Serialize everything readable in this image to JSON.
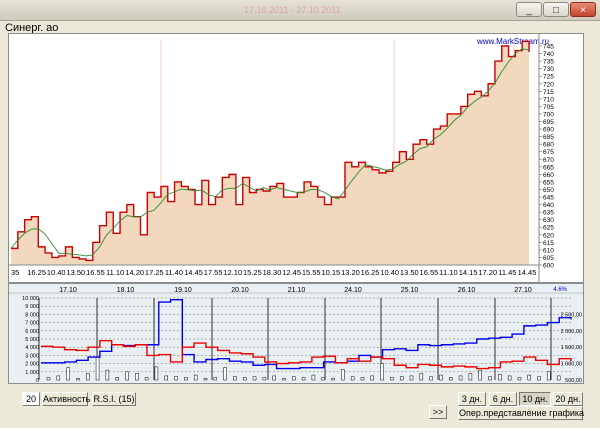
{
  "window": {
    "title_faint": "17.10.2011 - 27.10.2011",
    "minimize": "_",
    "maximize": "□",
    "close": "×"
  },
  "chart": {
    "title": "Синерг. ао",
    "watermark": "www.MarkStream.ru",
    "percent_label": "4.6%"
  },
  "price_axis": [
    "745",
    "740",
    "735",
    "730",
    "725",
    "720",
    "715",
    "710",
    "705",
    "700",
    "695",
    "690",
    "685",
    "680",
    "675",
    "670",
    "665",
    "660",
    "655",
    "650",
    "645",
    "640",
    "635",
    "630",
    "625",
    "620",
    "615",
    "610",
    "605",
    "600"
  ],
  "time_axis": [
    "35",
    "16.25",
    "10.40",
    "13.50",
    "16.55",
    "11.10",
    "14.20",
    "17.25",
    "11.40",
    "14.45",
    "17.55",
    "12.10",
    "15.25",
    "18.30",
    "12.45",
    "15.55",
    "10.15",
    "13.20",
    "16.25",
    "10.40",
    "13.50",
    "16.55",
    "11.10",
    "14.15",
    "17.20",
    "11.45",
    "14.45"
  ],
  "date_axis": [
    "17.10",
    "18.10",
    "19.10",
    "20.10",
    "21.10",
    "24.10",
    "25.10",
    "26.10",
    "27.10"
  ],
  "left_axis": [
    "10 000",
    "9 000",
    "8 000",
    "7 000",
    "6 000",
    "5 000",
    "4 000",
    "3 000",
    "2 000",
    "1 000",
    "0"
  ],
  "right_axis": [
    "2 500,00",
    "2 000,00",
    "1 500,00",
    "1 000,00",
    "500,00"
  ],
  "colors": {
    "price_line": "#cc0000",
    "price_fill": "#f2d8bf",
    "ma": "#2e8b2e",
    "blue": "#0000ee",
    "red": "#ee0000"
  },
  "toolbar": {
    "period_box": "20",
    "activity": "Активность",
    "rsi": "R.S.I. (15)",
    "forward": ">>",
    "range_3": "3 дн.",
    "range_6": "6 дн.",
    "range_10": "10 дн.",
    "range_20": "20 дн.",
    "oper_view": "Опер.представление графика"
  },
  "chart_data": {
    "type": "line",
    "y_range": [
      600,
      745
    ],
    "price": [
      611,
      622,
      630,
      632,
      612,
      608,
      605,
      606,
      612,
      605,
      604,
      603,
      615,
      626,
      635,
      621,
      635,
      640,
      632,
      620,
      648,
      645,
      652,
      642,
      655,
      652,
      650,
      640,
      656,
      640,
      645,
      658,
      660,
      640,
      658,
      648,
      650,
      649,
      652,
      654,
      645,
      645,
      648,
      655,
      652,
      645,
      640,
      645,
      645,
      668,
      665,
      668,
      665,
      663,
      661,
      662,
      668,
      675,
      670,
      680,
      683,
      680,
      690,
      692,
      700,
      700,
      705,
      713,
      715,
      712,
      720,
      735,
      745,
      738,
      742,
      748,
      741
    ],
    "lower_blue": [
      2.1,
      2.1,
      2.2,
      2.4,
      2.8,
      3.5,
      4.3,
      4.2,
      4.3,
      4.3,
      9.5,
      9.8,
      3.1,
      2.2,
      2.5,
      2.6,
      2.3,
      2.2,
      1.8,
      1.9,
      1.4,
      1.4,
      1.5,
      1.5,
      2.2,
      2.1,
      2.3,
      3.0,
      2.8,
      3.7,
      3.8,
      3.6,
      4.3,
      4.2,
      4.3,
      4.4,
      4.5,
      5.0,
      5.1,
      5.2,
      5.6,
      6.6,
      6.7,
      7.0,
      7.6,
      7.4
    ],
    "lower_red": [
      4.1,
      4.0,
      3.7,
      3.6,
      4.0,
      4.8,
      4.3,
      4.1,
      4.3,
      3.0,
      3.1,
      2.2,
      4.0,
      4.5,
      4.0,
      3.6,
      3.3,
      3.2,
      2.8,
      2.2,
      2.0,
      2.1,
      2.2,
      2.8,
      2.9,
      2.1,
      2.6,
      2.3,
      2.8,
      2.6,
      1.8,
      1.5,
      1.9,
      1.8,
      1.6,
      1.7,
      1.6,
      1.4,
      1.5,
      2.2,
      2.3,
      2.8,
      2.4,
      1.9,
      2.6,
      2.3
    ],
    "volume": [
      0.3,
      0.5,
      1.5,
      0.2,
      0.8,
      2.8,
      1.2,
      0.3,
      1.0,
      0.8,
      0.3,
      1.6,
      0.5,
      0.4,
      0.3,
      0.6,
      0.2,
      0.3,
      1.5,
      0.4,
      0.3,
      0.4,
      0.3,
      0.5,
      0.2,
      0.4,
      0.3,
      0.6,
      0.3,
      0.2,
      1.3,
      0.4,
      0.3,
      0.5,
      2.0,
      0.3,
      0.4,
      0.5,
      0.8,
      0.4,
      0.6,
      0.3,
      0.5,
      0.8,
      1.2,
      0.4,
      0.7,
      0.5,
      0.3,
      0.6,
      0.4,
      1.0,
      0.5
    ]
  }
}
